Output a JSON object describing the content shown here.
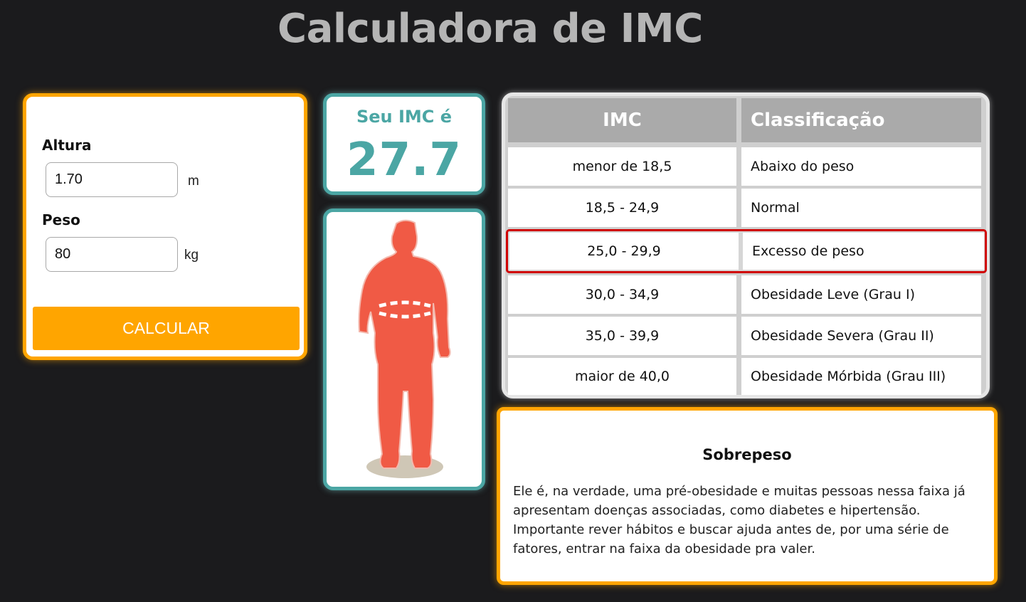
{
  "header": {
    "title": "Calculadora de IMC"
  },
  "form": {
    "height_label": "Altura",
    "height_value": "1.70",
    "height_unit": "m",
    "weight_label": "Peso",
    "weight_value": "80",
    "weight_unit": "kg",
    "button_label": "CALCULAR"
  },
  "result": {
    "label": "Seu IMC é",
    "value": "27.7"
  },
  "table": {
    "headers": [
      "IMC",
      "Classificação"
    ],
    "rows": [
      [
        "menor de 18,5",
        "Abaixo do peso"
      ],
      [
        "18,5 - 24,9",
        "Normal"
      ],
      [
        "25,0 - 29,9",
        "Excesso de peso"
      ],
      [
        "30,0 - 34,9",
        "Obesidade Leve (Grau I)"
      ],
      [
        "35,0 - 39,9",
        "Obesidade Severa (Grau II)"
      ],
      [
        "maior de 40,0",
        "Obesidade Mórbida (Grau III)"
      ]
    ],
    "highlighted_row": 2
  },
  "description": {
    "title": "Sobrepeso",
    "text": "Ele é, na verdade, uma pré-obesidade e muitas pessoas nessa faixa já apresentam doenças associadas, como diabetes e hipertensão. Importante rever hábitos e buscar ajuda antes de, por uma série de fatores, entrar na faixa da obesidade pra valer."
  },
  "colors": {
    "background": "#1b1b1d",
    "accent_orange": "#ffa500",
    "accent_teal": "#4ba6a4",
    "figure": "#f05a45",
    "highlight_border": "#d00000"
  }
}
